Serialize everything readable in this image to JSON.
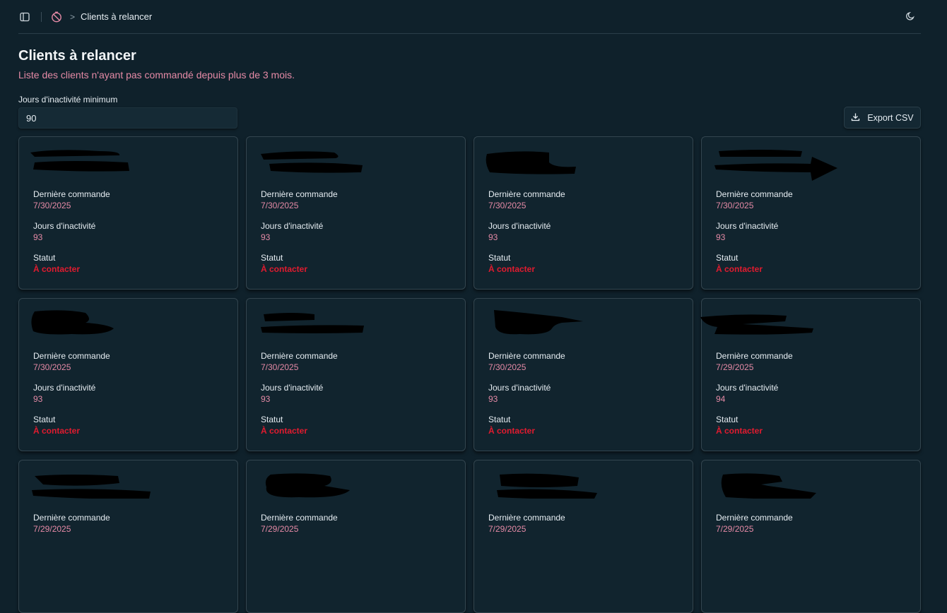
{
  "breadcrumb": {
    "current": "Clients à relancer"
  },
  "header": {
    "title": "Clients à relancer",
    "subtitle": "Liste des clients n'ayant pas commandé depuis plus de 3 mois."
  },
  "filter": {
    "label": "Jours d'inactivité minimum",
    "value": "90"
  },
  "export": {
    "label": "Export CSV"
  },
  "field_labels": {
    "last_order": "Dernière commande",
    "inactivity": "Jours d'inactivité",
    "status": "Statut"
  },
  "colors": {
    "background": "#0f212b",
    "accent": "#e58aa6",
    "status_red": "#e01b2f"
  },
  "clients": [
    {
      "last_order": "7/30/2025",
      "inactivity": "93",
      "status": "À contacter"
    },
    {
      "last_order": "7/30/2025",
      "inactivity": "93",
      "status": "À contacter"
    },
    {
      "last_order": "7/30/2025",
      "inactivity": "93",
      "status": "À contacter"
    },
    {
      "last_order": "7/30/2025",
      "inactivity": "93",
      "status": "À contacter"
    },
    {
      "last_order": "7/30/2025",
      "inactivity": "93",
      "status": "À contacter"
    },
    {
      "last_order": "7/30/2025",
      "inactivity": "93",
      "status": "À contacter"
    },
    {
      "last_order": "7/30/2025",
      "inactivity": "93",
      "status": "À contacter"
    },
    {
      "last_order": "7/29/2025",
      "inactivity": "94",
      "status": "À contacter"
    },
    {
      "last_order": "7/29/2025"
    },
    {
      "last_order": "7/29/2025"
    },
    {
      "last_order": "7/29/2025"
    },
    {
      "last_order": "7/29/2025"
    }
  ]
}
